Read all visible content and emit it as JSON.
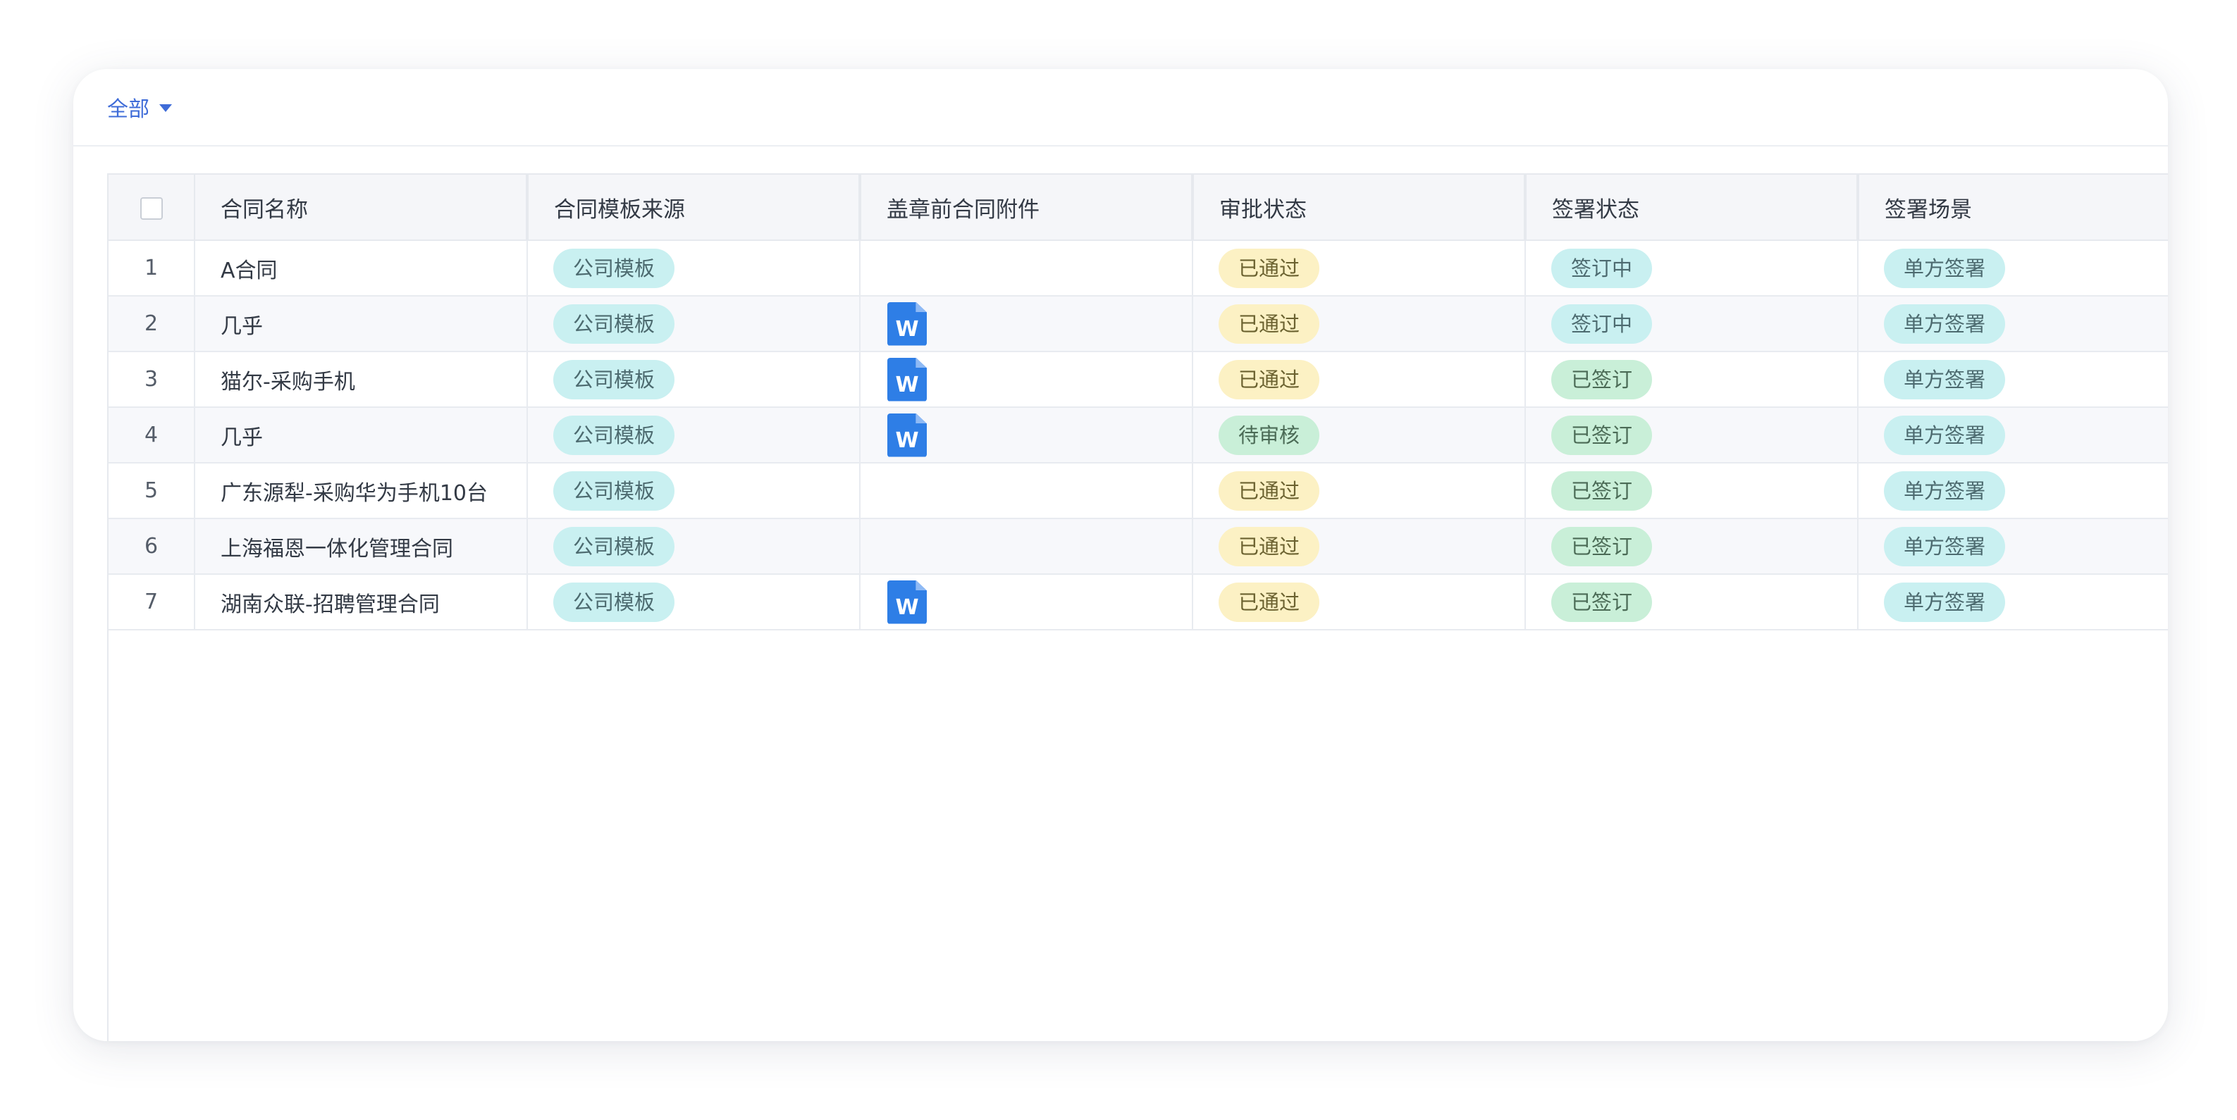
{
  "filter": {
    "label": "全部"
  },
  "table": {
    "columns": [
      "合同名称",
      "合同模板来源",
      "盖章前合同附件",
      "审批状态",
      "签署状态",
      "签署场景"
    ],
    "rows": [
      {
        "index": "1",
        "name": "A合同",
        "source": "公司模板",
        "attachment": "",
        "approval": "已通过",
        "approval_color": "yellow",
        "sign_status": "签订中",
        "sign_color": "cyan",
        "scene": "单方签署"
      },
      {
        "index": "2",
        "name": "几乎",
        "source": "公司模板",
        "attachment": "word-icon",
        "approval": "已通过",
        "approval_color": "yellow",
        "sign_status": "签订中",
        "sign_color": "cyan",
        "scene": "单方签署"
      },
      {
        "index": "3",
        "name": "猫尔-采购手机",
        "source": "公司模板",
        "attachment": "word-icon",
        "approval": "已通过",
        "approval_color": "yellow",
        "sign_status": "已签订",
        "sign_color": "green",
        "scene": "单方签署"
      },
      {
        "index": "4",
        "name": "几乎",
        "source": "公司模板",
        "attachment": "word-icon",
        "approval": "待审核",
        "approval_color": "green",
        "sign_status": "已签订",
        "sign_color": "green",
        "scene": "单方签署"
      },
      {
        "index": "5",
        "name": "广东源犁-采购华为手机10台",
        "source": "公司模板",
        "attachment": "",
        "approval": "已通过",
        "approval_color": "yellow",
        "sign_status": "已签订",
        "sign_color": "green",
        "scene": "单方签署"
      },
      {
        "index": "6",
        "name": "上海福恩一体化管理合同",
        "source": "公司模板",
        "attachment": "",
        "approval": "已通过",
        "approval_color": "yellow",
        "sign_status": "已签订",
        "sign_color": "green",
        "scene": "单方签署"
      },
      {
        "index": "7",
        "name": "湖南众联-招聘管理合同",
        "source": "公司模板",
        "attachment": "word-icon",
        "approval": "已通过",
        "approval_color": "yellow",
        "sign_status": "已签订",
        "sign_color": "green",
        "scene": "单方签署"
      }
    ],
    "word_icon_letter": "W"
  },
  "colors": {
    "accent": "#3f6cd8",
    "tag_cyan": "#c9f0f1",
    "tag_yellow": "#fcf1c4",
    "tag_green": "#c9efd8",
    "word_blue": "#2e7ee6"
  }
}
